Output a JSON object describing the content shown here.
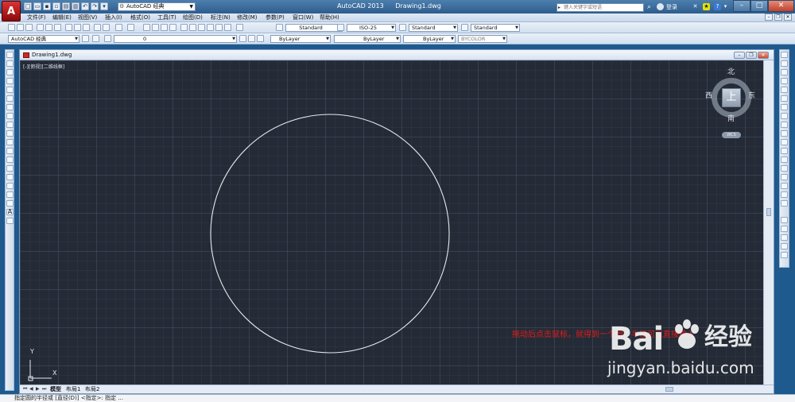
{
  "app": {
    "logo_letter": "A",
    "title": "AutoCAD 2013",
    "document": "Drawing1.dwg",
    "workspace": "AutoCAD 经典"
  },
  "search": {
    "placeholder": "键入关键字或短语",
    "login_label": "登录"
  },
  "menu": {
    "items": [
      "文件(F)",
      "编辑(E)",
      "视图(V)",
      "插入(I)",
      "格式(O)",
      "工具(T)",
      "绘图(D)",
      "标注(N)",
      "修改(M)",
      "参数(P)",
      "窗口(W)",
      "帮助(H)"
    ]
  },
  "toolbar1": {
    "text_style": "Standard",
    "dim_style": "ISO-25",
    "table_style": "Standard",
    "multileader_style": "Standard"
  },
  "toolbar2": {
    "workspace": "AutoCAD 经典",
    "layer": "0",
    "color": "ByLayer",
    "linetype": "ByLayer",
    "lineweight": "ByLayer",
    "plotstyle": "BYCOLOR"
  },
  "drawing": {
    "tab_title": "Drawing1.dwg",
    "viewport_label": "[-][俯视][二维线框]",
    "annotation": "拖动后点击鼠标，就得到一个圆，半径可以直接输入"
  },
  "viewcube": {
    "face": "上",
    "north": "北",
    "south": "南",
    "east": "东",
    "west": "西",
    "wcs": "WCS"
  },
  "ucs": {
    "x": "X",
    "y": "Y"
  },
  "layout_tabs": [
    "模型",
    "布局1",
    "布局2"
  ],
  "watermark": {
    "logo": "Bai",
    "logo_suffix": "经验",
    "url": "jingyan.baidu.com"
  },
  "command_line": "指定圆的半径或 [直径(D)] <指定>: 指定 ...",
  "colors": {
    "canvas": "#242b36",
    "circle": "#e6e9ee",
    "annotation": "#e21b1b",
    "title_bar": "#2d5c8c"
  }
}
